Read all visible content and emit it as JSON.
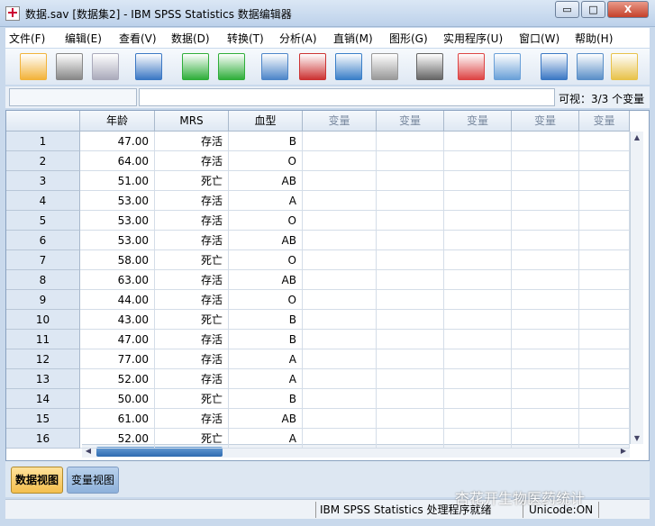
{
  "window": {
    "title": "数据.sav [数据集2] - IBM SPSS Statistics 数据编辑器",
    "minimize": "▭",
    "maximize": "□",
    "close": "X"
  },
  "menu": [
    "文件(F)",
    "编辑(E)",
    "查看(V)",
    "数据(D)",
    "转换(T)",
    "分析(A)",
    "直销(M)",
    "图形(G)",
    "实用程序(U)",
    "窗口(W)",
    "帮助(H)"
  ],
  "toolbar": [
    "open-folder-icon",
    "save-icon",
    "print-icon",
    "recall-dialog-icon",
    "undo-icon",
    "redo-icon",
    "goto-case-icon",
    "goto-variable-icon",
    "variables-icon",
    "run-descriptives-icon",
    "find-icon",
    "insert-cases-icon",
    "insert-variable-icon",
    "split-file-icon",
    "weight-cases-icon",
    "select-cases-icon"
  ],
  "cellbar": {
    "cell_name": "",
    "cell_value": "",
    "visible": "可视：3/3 个变量"
  },
  "grid": {
    "columns": [
      "年龄",
      "MRS",
      "血型",
      "变量",
      "变量",
      "变量",
      "变量",
      "变量"
    ],
    "rows": [
      [
        "1",
        "47.00",
        "存活",
        "B"
      ],
      [
        "2",
        "64.00",
        "存活",
        "O"
      ],
      [
        "3",
        "51.00",
        "死亡",
        "AB"
      ],
      [
        "4",
        "53.00",
        "存活",
        "A"
      ],
      [
        "5",
        "53.00",
        "存活",
        "O"
      ],
      [
        "6",
        "53.00",
        "存活",
        "AB"
      ],
      [
        "7",
        "58.00",
        "死亡",
        "O"
      ],
      [
        "8",
        "63.00",
        "存活",
        "AB"
      ],
      [
        "9",
        "44.00",
        "存活",
        "O"
      ],
      [
        "10",
        "43.00",
        "死亡",
        "B"
      ],
      [
        "11",
        "47.00",
        "存活",
        "B"
      ],
      [
        "12",
        "77.00",
        "存活",
        "A"
      ],
      [
        "13",
        "52.00",
        "存活",
        "A"
      ],
      [
        "14",
        "50.00",
        "死亡",
        "B"
      ],
      [
        "15",
        "61.00",
        "存活",
        "AB"
      ],
      [
        "16",
        "52.00",
        "死亡",
        "A"
      ]
    ]
  },
  "tabs": {
    "data_view": "数据视图",
    "variable_view": "变量视图",
    "active": "data_view"
  },
  "status": {
    "ready": "IBM SPSS Statistics 处理程序就绪",
    "unicode": "Unicode:ON"
  },
  "watermark": "杏花开生物医药统计"
}
